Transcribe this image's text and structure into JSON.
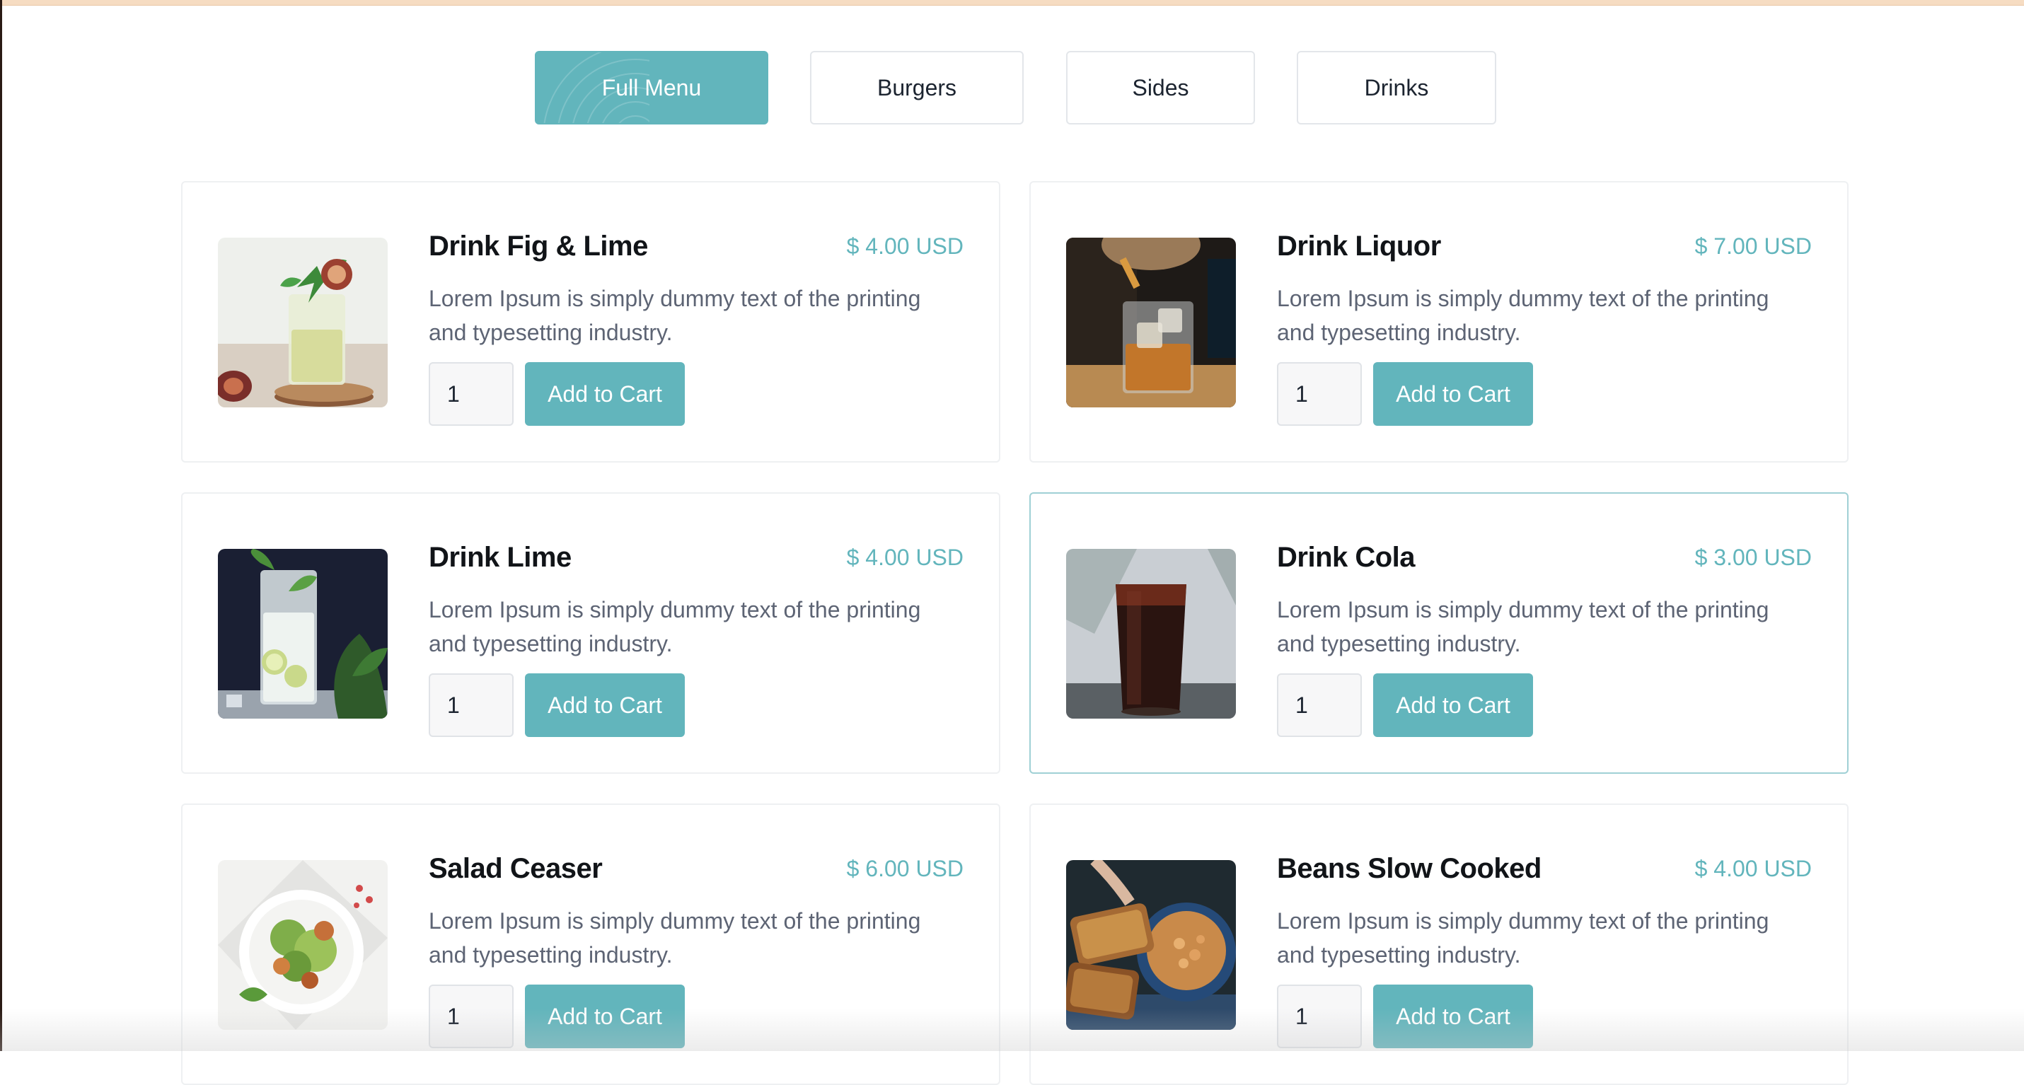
{
  "tabs": [
    {
      "label": "Full Menu",
      "active": true
    },
    {
      "label": "Burgers",
      "active": false
    },
    {
      "label": "Sides",
      "active": false
    },
    {
      "label": "Drinks",
      "active": false
    }
  ],
  "colors": {
    "accent": "#62b5bc",
    "title": "#111418",
    "text": "#5d6474",
    "border": "#eef0f2"
  },
  "items": [
    {
      "title": "Drink Fig & Lime",
      "price": "$ 4.00 USD",
      "description": "Lorem Ipsum is simply dummy text of the printing and typesetting industry.",
      "quantity": "1",
      "button": "Add to Cart",
      "image": "fig-lime-drink-photo"
    },
    {
      "title": "Drink Liquor",
      "price": "$ 7.00 USD",
      "description": "Lorem Ipsum is simply dummy text of the printing and typesetting industry.",
      "quantity": "1",
      "button": "Add to Cart",
      "image": "liquor-pour-photo"
    },
    {
      "title": "Drink Lime",
      "price": "$ 4.00 USD",
      "description": "Lorem Ipsum is simply dummy text of the printing and typesetting industry.",
      "quantity": "1",
      "button": "Add to Cart",
      "image": "lime-drink-photo"
    },
    {
      "title": "Drink Cola",
      "price": "$ 3.00 USD",
      "description": "Lorem Ipsum is simply dummy text of the printing and typesetting industry.",
      "quantity": "1",
      "button": "Add to Cart",
      "image": "cola-glass-photo"
    },
    {
      "title": "Salad Ceaser",
      "price": "$ 6.00 USD",
      "description": "Lorem Ipsum is simply dummy text of the printing and typesetting industry.",
      "quantity": "1",
      "button": "Add to Cart",
      "image": "salad-bowl-photo"
    },
    {
      "title": "Beans Slow Cooked",
      "price": "$ 4.00 USD",
      "description": "Lorem Ipsum is simply dummy text of the printing and typesetting industry.",
      "quantity": "1",
      "button": "Add to Cart",
      "image": "beans-toast-photo"
    }
  ]
}
